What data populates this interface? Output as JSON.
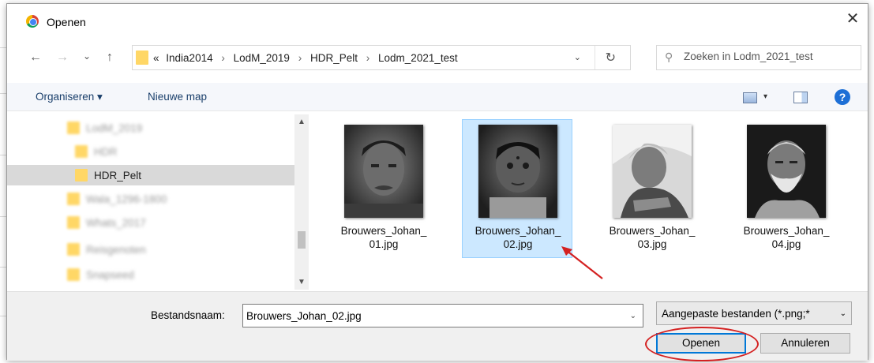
{
  "dialog": {
    "title": "Openen",
    "close_glyph": "✕"
  },
  "nav": {
    "back_glyph": "←",
    "forward_glyph": "→",
    "recent_glyph": "⌄",
    "up_glyph": "↑",
    "breadcrumb_prefix": "«",
    "breadcrumbs": [
      "India2014",
      "LodM_2019",
      "HDR_Pelt",
      "Lodm_2021_test"
    ],
    "separator": "›",
    "refresh_glyph": "↻",
    "search_placeholder": "Zoeken in Lodm_2021_test",
    "dropdown_glyph": "⌄"
  },
  "toolbar": {
    "organize_label": "Organiseren ▾",
    "new_folder_label": "Nieuwe map",
    "help_label": "?",
    "view_dropdown_glyph": "▾"
  },
  "sidebar": {
    "items": [
      {
        "label": "LodM_2019",
        "blurred": true
      },
      {
        "label": "HDR",
        "blurred": true
      },
      {
        "label": "HDR_Pelt",
        "blurred": false,
        "selected": true
      },
      {
        "label": "Wala_1296-1800",
        "blurred": true
      },
      {
        "label": "Whats_2017",
        "blurred": true
      },
      {
        "label": "Reisgenoten",
        "blurred": true
      },
      {
        "label": "Snapseed",
        "blurred": true
      }
    ],
    "scroll_up_glyph": "▲",
    "scroll_down_glyph": "▼"
  },
  "files": [
    {
      "name_line1": "Brouwers_Johan_",
      "name_line2": "01.jpg",
      "selected": false,
      "icon": "portrait-photo"
    },
    {
      "name_line1": "Brouwers_Johan_",
      "name_line2": "02.jpg",
      "selected": true,
      "icon": "portrait-photo"
    },
    {
      "name_line1": "Brouwers_Johan_",
      "name_line2": "03.jpg",
      "selected": false,
      "icon": "portrait-photo"
    },
    {
      "name_line1": "Brouwers_Johan_",
      "name_line2": "04.jpg",
      "selected": false,
      "icon": "portrait-photo"
    }
  ],
  "footer": {
    "filename_label": "Bestandsnaam:",
    "filename_value": "Brouwers_Johan_02.jpg",
    "filter_value": "Aangepaste bestanden (*.png;*",
    "dropdown_glyph": "⌄",
    "open_label": "Openen",
    "cancel_label": "Annuleren"
  },
  "colors": {
    "accent": "#0078d7",
    "selection": "#cce8ff",
    "annotation": "#d42121",
    "folder": "#ffd766"
  }
}
